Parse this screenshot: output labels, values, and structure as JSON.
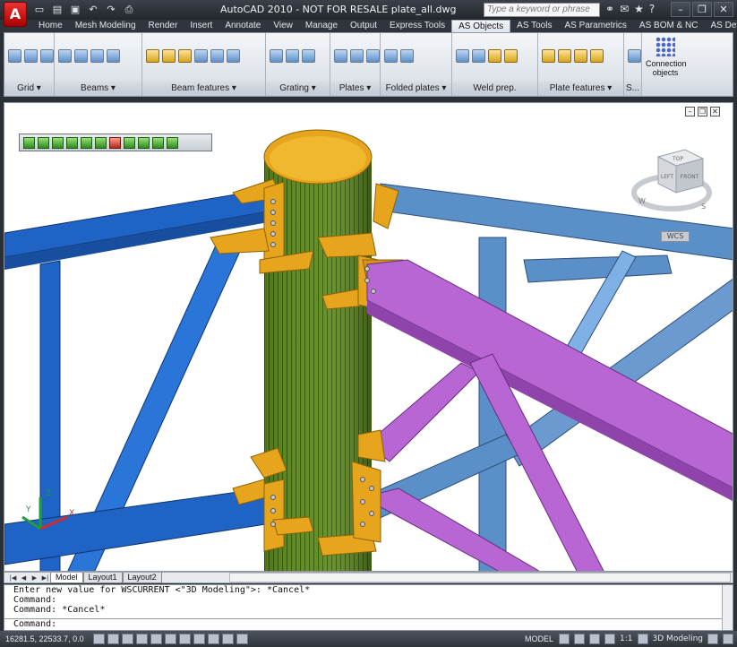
{
  "window": {
    "title": "AutoCAD 2010 - NOT FOR RESALE    plate_all.dwg",
    "app_button_label": "A",
    "search_placeholder": "Type a keyword or phrase"
  },
  "ribbon_tabs": [
    {
      "label": "Home"
    },
    {
      "label": "Mesh Modeling"
    },
    {
      "label": "Render"
    },
    {
      "label": "Insert"
    },
    {
      "label": "Annotate"
    },
    {
      "label": "View"
    },
    {
      "label": "Manage"
    },
    {
      "label": "Output"
    },
    {
      "label": "Express Tools"
    },
    {
      "label": "AS Objects"
    },
    {
      "label": "AS Tools"
    },
    {
      "label": "AS Parametrics"
    },
    {
      "label": "AS BOM & NC"
    },
    {
      "label": "AS Detailing"
    }
  ],
  "active_tab": "AS Objects",
  "panels": [
    {
      "title": "Grid ▾"
    },
    {
      "title": "Beams ▾"
    },
    {
      "title": "Beam features ▾"
    },
    {
      "title": "Grating ▾"
    },
    {
      "title": "Plates ▾"
    },
    {
      "title": "Folded plates ▾"
    },
    {
      "title": "Weld prep."
    },
    {
      "title": "Plate features ▾"
    },
    {
      "title": "S..."
    }
  ],
  "connection_button": {
    "label_line1": "Connection",
    "label_line2": "objects"
  },
  "viewcube": {
    "top": "TOP",
    "left": "LEFT",
    "front": "FRONT",
    "w": "W",
    "s": "S",
    "wcs_label": "WCS"
  },
  "ucs": {
    "x": "X",
    "y": "Y",
    "z": "Z"
  },
  "layout_tabs": [
    {
      "label": "Model"
    },
    {
      "label": "Layout1"
    },
    {
      "label": "Layout2"
    }
  ],
  "command_history": [
    "Enter new value for WSCURRENT <\"3D Modeling\">: *Cancel*",
    "Command:",
    "Command: *Cancel*"
  ],
  "command_prompt": "Command:",
  "status": {
    "coordinates": "16281.5, 22533.7, 0.0",
    "model_label": "MODEL",
    "annotation_scale": "1:1",
    "workspace": "3D Modeling"
  },
  "colors": {
    "column": "#5d8a1a",
    "cap_plates": "#e6a51c",
    "blue_beams": "#1f63c4",
    "steel_beams": "#5b8fc7",
    "purple_beams": "#b866d4"
  }
}
